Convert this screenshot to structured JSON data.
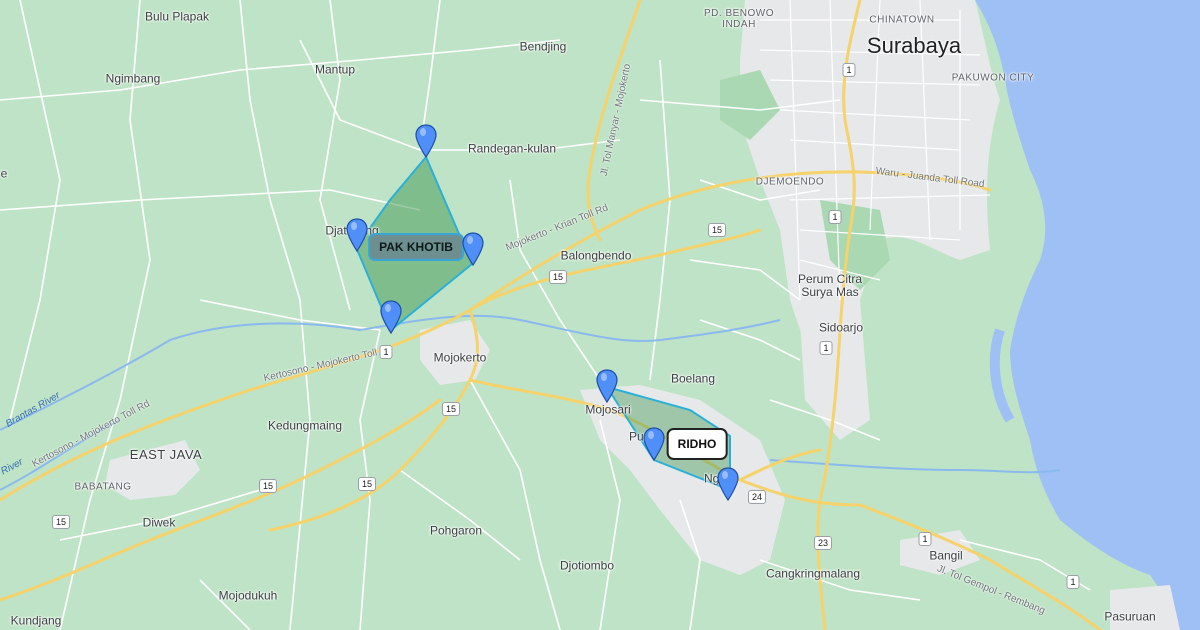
{
  "map": {
    "colors": {
      "land": "#bfe3c6",
      "sea": "#9ec0f5",
      "urban": "#e8eaed",
      "road_major": "#f6d26b",
      "road_minor": "#ffffff",
      "polygon_fill": "#4a9e5c",
      "polygon_stroke": "#2ab0d8",
      "pin": "#4285f4"
    },
    "places": {
      "surabaya": "Surabaya",
      "chinatown": "CHINATOWN",
      "pakuwon_city": "PAKUWON CITY",
      "pd_benowo": "PD. BENOWO\nINDAH",
      "bulu_plapak": "Bulu Plapak",
      "bendjing": "Bendjing",
      "mantup": "Mantup",
      "ngimbang": "Ngimbang",
      "randegan_kulan": "Randegan-kulan",
      "djemoendo": "DJEMOENDO",
      "djatiloegg": "Djatiloeng",
      "balongbendo": "Balongbendo",
      "perum_citra": "Perum Citra\nSurya Mas",
      "sidoarjo": "Sidoarjo",
      "mojokerto": "Mojokerto",
      "boelang": "Boelang",
      "mojosari": "Mojosari",
      "pungging": "Pungging",
      "ngoro": "Ngoro",
      "kedungmaing": "Kedungmaing",
      "east_java": "EAST JAVA",
      "babatang": "BABATANG",
      "diwek": "Diwek",
      "pohgaron": "Pohgaron",
      "djotiombo": "Djotiombo",
      "bangil": "Bangil",
      "cangkringmalang": "Cangkringmalang",
      "mojodukuh": "Mojodukuh",
      "kundjang": "Kundjang",
      "pasuruan": "Pasuruan",
      "edge_e": "e"
    },
    "roads": {
      "toll_manyar": "Jl. Tol Manyar - Mojokerto",
      "toll_krian": "Mojokerto - Krian Toll Rd",
      "toll_kertosono": "Kertosono - Mojokerto Toll Rd",
      "toll_kertosono2": "Kertosono - Mojokerto Toll Rd",
      "toll_waru": "Waru - Juanda Toll Road",
      "toll_gempol": "Jl. Tol Gempol - Rembang"
    },
    "rivers": {
      "brantas": "Brantas River",
      "river_w": "River"
    },
    "shields": {
      "s1a": "1",
      "s1b": "1",
      "s1c": "1",
      "s1d": "1",
      "s1e": "1",
      "s15a": "15",
      "s15b": "15",
      "s15c": "15",
      "s15d": "15",
      "s15e": "15",
      "s15f": "15",
      "s24": "24",
      "s23": "23"
    },
    "polygons": {
      "khotib_label": "PAK KHOTIB",
      "ridho_label": "RIDHO"
    }
  }
}
